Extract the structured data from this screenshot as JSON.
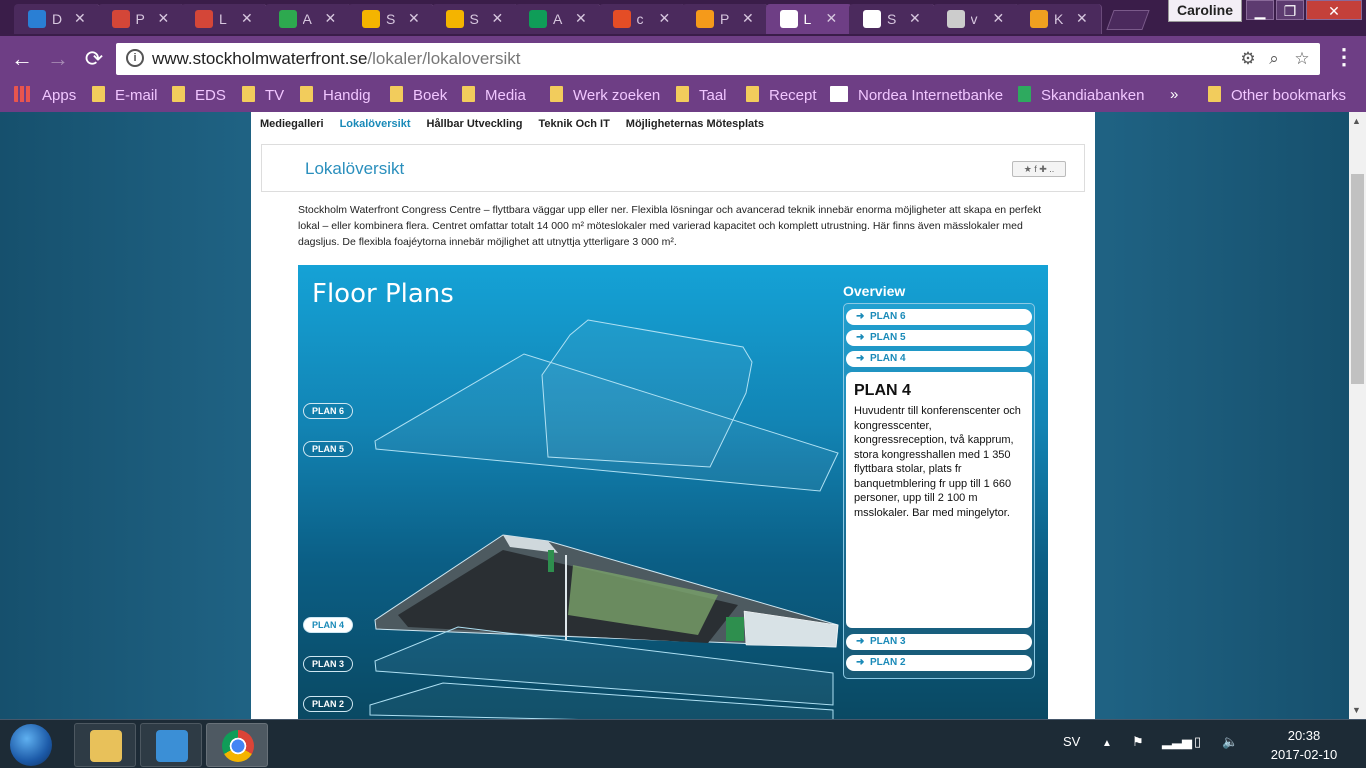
{
  "browser": {
    "tabs": [
      {
        "letter": "D",
        "icon": "pf-icon",
        "color": "#2a7fd4"
      },
      {
        "letter": "P",
        "icon": "gmail-icon",
        "color": "#d44638"
      },
      {
        "letter": "L",
        "icon": "gmail-icon",
        "color": "#d44638"
      },
      {
        "letter": "A",
        "icon": "google-drive-icon",
        "color": "#2da94f"
      },
      {
        "letter": "S",
        "icon": "google-slides-icon",
        "color": "#f4b400"
      },
      {
        "letter": "S",
        "icon": "google-slides-icon",
        "color": "#f4b400"
      },
      {
        "letter": "A",
        "icon": "google-sheets-icon",
        "color": "#0f9d58"
      },
      {
        "letter": "c",
        "icon": "joomla-icon",
        "color": "#e44d26"
      },
      {
        "letter": "P",
        "icon": "tv-icon",
        "color": "#f59a1a"
      },
      {
        "letter": "L",
        "icon": "page-icon",
        "color": "#ffffff"
      },
      {
        "letter": "S",
        "icon": "page-icon",
        "color": "#ffffff"
      },
      {
        "letter": "v",
        "icon": "page-icon",
        "color": "#cccccc"
      },
      {
        "letter": "K",
        "icon": "swirl-icon",
        "color": "#f0a020"
      }
    ],
    "active_tab": 9,
    "user": "Caroline",
    "url_host": "www.stockholmwaterfront.se",
    "url_path": "/lokaler/lokaloversikt",
    "bookmarks": [
      {
        "label": "Apps",
        "icon": "apps-grid-icon"
      },
      {
        "label": "E-mail",
        "icon": "folder-icon"
      },
      {
        "label": "EDS",
        "icon": "folder-icon"
      },
      {
        "label": "TV",
        "icon": "folder-icon"
      },
      {
        "label": "Handig",
        "icon": "folder-icon"
      },
      {
        "label": "Boek",
        "icon": "folder-icon"
      },
      {
        "label": "Media",
        "icon": "folder-icon"
      },
      {
        "label": "Werk zoeken",
        "icon": "folder-icon"
      },
      {
        "label": "Taal",
        "icon": "folder-icon"
      },
      {
        "label": "Recept",
        "icon": "folder-icon"
      },
      {
        "label": "Nordea Internetbanke",
        "icon": "nordea-icon"
      },
      {
        "label": "Skandiabanken",
        "icon": "skandia-icon"
      }
    ],
    "overflow": "»",
    "other_bookmarks": "Other bookmarks"
  },
  "site": {
    "subnav": [
      "Mediegalleri",
      "Lokalöversikt",
      "Hållbar Utveckling",
      "Teknik Och IT",
      "Möjligheternas Mötesplats"
    ],
    "subnav_active": 1,
    "page_title": "Lokalöversikt",
    "intro": "Stockholm Waterfront Congress Centre – flyttbara väggar upp eller ner. Flexibla lösningar och avancerad teknik innebär enorma möjligheter att skapa en perfekt lokal – eller kombinera flera. Centret omfattar totalt 14 000 m² möteslokaler med varierad kapacitet och komplett utrustning. Här finns även mässlokaler med dagsljus. De flexibla foajéytorna innebär möjlighet att utnyttja ytterligare 3 000 m².",
    "floorplans": {
      "title": "Floor Plans",
      "levels": [
        "PLAN 6",
        "PLAN 5",
        "PLAN 4",
        "PLAN 3",
        "PLAN 2"
      ],
      "selected": "PLAN 4",
      "overview_title": "Overview",
      "overview_top": [
        "PLAN 6",
        "PLAN 5",
        "PLAN 4"
      ],
      "overview_bottom": [
        "PLAN 3",
        "PLAN 2"
      ],
      "panel_title": "PLAN 4",
      "panel_text": "Huvudentr till konferenscenter och kongresscenter, kongressreception, två kapprum, stora kongresshallen med 1 350 flyttbara stolar, plats fr banquetmblering fr upp till 1 660 personer, upp till 2 100 m msslokaler. Bar med mingelytor."
    }
  },
  "taskbar": {
    "apps": [
      {
        "name": "file-explorer",
        "color": "#e8c15a"
      },
      {
        "name": "media-player",
        "color": "#3b8fd6"
      },
      {
        "name": "chrome",
        "color": "#db4437"
      }
    ],
    "language": "SV",
    "time": "20:38",
    "date": "2017-02-10"
  }
}
